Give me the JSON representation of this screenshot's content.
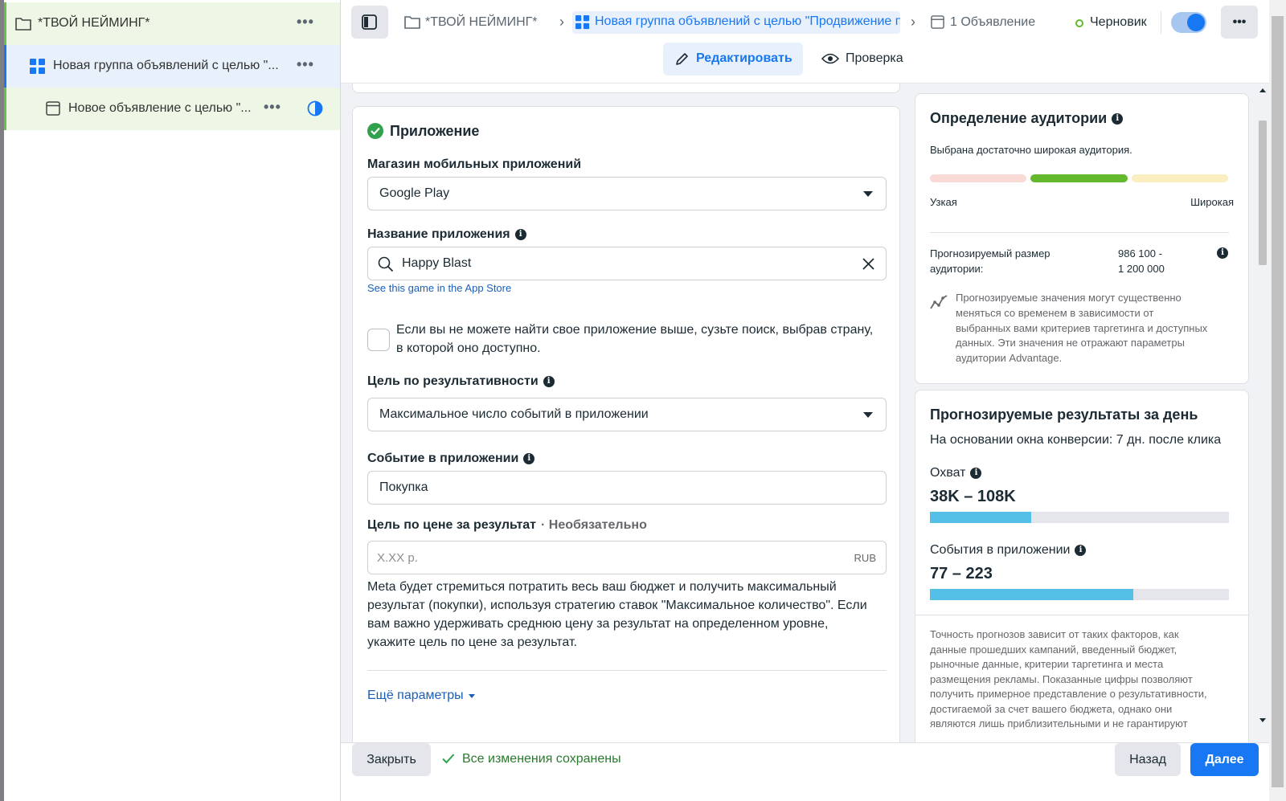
{
  "sidebar": {
    "campaign": {
      "label": "*ТВОЙ НЕЙМИНГ*"
    },
    "adset": {
      "label": "Новая группа объявлений с целью \"..."
    },
    "ad": {
      "label": "Новое объявление с целью \"..."
    },
    "more_glyph": "•••"
  },
  "topbar": {
    "crumb_campaign": "*ТВОЙ НЕЙМИНГ*",
    "crumb_adset": "Новая группа объявлений с целью \"Продвижение п",
    "crumb_ad": "1 Объявление",
    "status": "Черновик",
    "toggle_on": true,
    "tab_edit": "Редактировать",
    "tab_review": "Проверка"
  },
  "app_section": {
    "title": "Приложение",
    "store_label": "Магазин мобильных приложений",
    "store_value": "Google Play",
    "app_name_label": "Название приложения",
    "app_name_value": "Happy Blast",
    "app_link": "See this game in the App Store",
    "country_checkbox_text_1": "Если вы не можете найти свое приложение выше, сузьте поиск, выбрав страну,",
    "country_checkbox_text_2": "в которой оно доступно.",
    "goal_label": "Цель по результативности",
    "goal_value": "Максимальное число событий в приложении",
    "event_label": "Событие в приложении",
    "event_value": "Покупка",
    "cost_label": "Цель по цене за результат",
    "cost_optional": "· Необязательно",
    "cost_placeholder": "X.XX р.",
    "cost_currency": "RUB",
    "cost_help_1": "Meta будет стремиться потратить весь ваш бюджет и получить максимальный",
    "cost_help_2": "результат (покупки), используя стратегию ставок \"Максимальное количество\". Если",
    "cost_help_3": "вам важно удерживать среднюю цену за результат на определенном уровне,",
    "cost_help_4": "укажите цель по цене за результат.",
    "more_params": "Ещё параметры"
  },
  "audience": {
    "title": "Определение аудитории",
    "subtitle": "Выбрана достаточно широкая аудитория.",
    "narrow": "Узкая",
    "wide": "Широкая",
    "size_label_1": "Прогнозируемый размер",
    "size_label_2": "аудитории:",
    "size_value_1": "986 100 -",
    "size_value_2": "1 200 000",
    "note_1": "Прогнозируемые значения могут существенно",
    "note_2": "меняться со временем в зависимости от",
    "note_3": "выбранных вами критериев таргетинга и доступных",
    "note_4": "данных. Эти значения не отражают параметры",
    "note_5": "аудитории Advantage."
  },
  "results": {
    "title": "Прогнозируемые результаты за день",
    "subtitle": "На основании окна конверсии: 7 дн. после клика",
    "reach_label": "Охват",
    "reach_value": "38K – 108K",
    "reach_fill": 0.34,
    "events_label": "События в приложении",
    "events_value": "77 – 223",
    "events_fill": 0.68,
    "disclaimer_1": "Точность прогнозов зависит от таких факторов, как",
    "disclaimer_2": "данные прошедших кампаний, введенный бюджет,",
    "disclaimer_3": "рыночные данные, критерии таргетинга и места",
    "disclaimer_4": "размещения рекламы. Показанные цифры позволяют",
    "disclaimer_5": "получить примерное представление о результативности,",
    "disclaimer_6": "достигаемой за счет вашего бюджета, однако они",
    "disclaimer_7": "являются лишь приблизительными и не гарантируют"
  },
  "footer": {
    "close": "Закрыть",
    "saved": "Все изменения сохранены",
    "back": "Назад",
    "next": "Далее"
  },
  "colors": {
    "accent": "#1877f2",
    "success": "#31a24c",
    "meter_green": "#63b82e",
    "meter_red": "#fadad6",
    "meter_yellow": "#fbeec0",
    "result_bar": "#54c0e8"
  }
}
